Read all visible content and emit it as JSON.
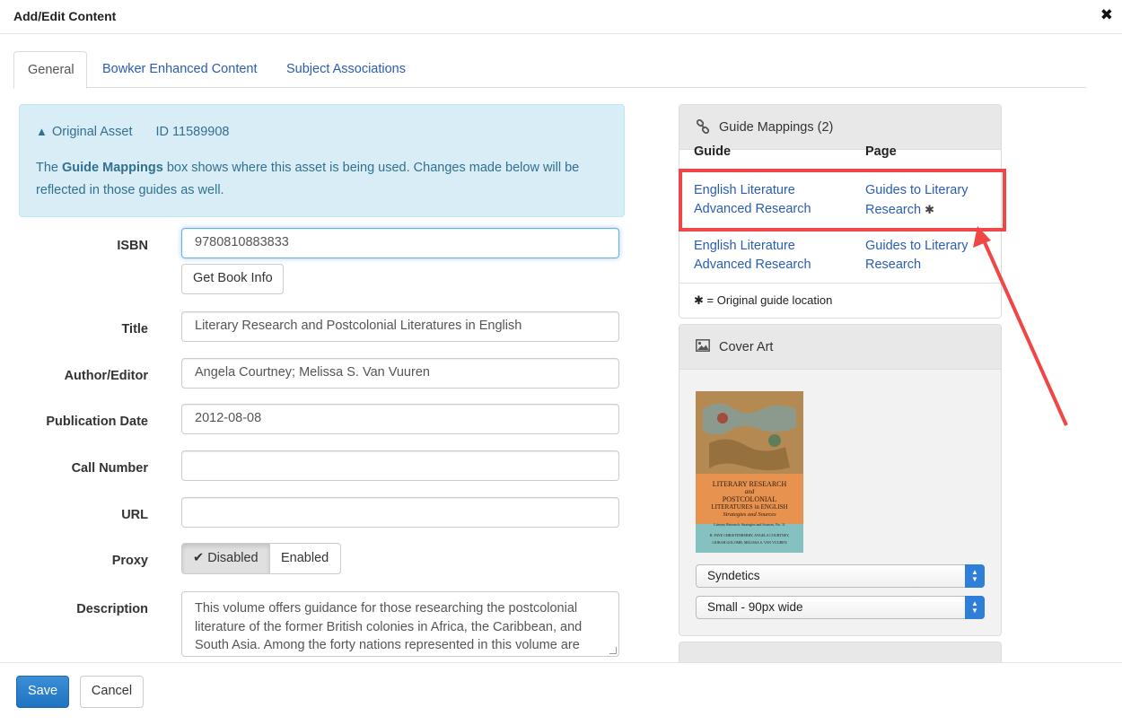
{
  "modal": {
    "title": "Add/Edit Content",
    "close_symbol": "✖"
  },
  "tabs": [
    {
      "label": "General",
      "active": true
    },
    {
      "label": "Bowker Enhanced Content",
      "active": false
    },
    {
      "label": "Subject Associations",
      "active": false
    }
  ],
  "info": {
    "asset_label": "Original Asset",
    "asset_id": "ID 11589908",
    "text_before": "The ",
    "text_bold": "Guide Mappings",
    "text_after": " box shows where this asset is being used. Changes made below will be reflected in those guides as well."
  },
  "form": {
    "isbn": {
      "label": "ISBN",
      "value": "9780810883833",
      "button": "Get Book Info"
    },
    "title": {
      "label": "Title",
      "value": "Literary Research and Postcolonial Literatures in English"
    },
    "author": {
      "label": "Author/Editor",
      "value": "Angela Courtney; Melissa S. Van Vuuren"
    },
    "pub_date": {
      "label": "Publication Date",
      "value": "2012-08-08"
    },
    "call_number": {
      "label": "Call Number",
      "value": ""
    },
    "url": {
      "label": "URL",
      "value": ""
    },
    "proxy": {
      "label": "Proxy",
      "options": [
        "Disabled",
        "Enabled"
      ],
      "selected": "Disabled"
    },
    "description": {
      "label": "Description",
      "value": "This volume offers guidance for those researching the postcolonial literature of the former British colonies in Africa, the Caribbean, and South Asia. Among the forty nations represented in this volume are"
    }
  },
  "guide_mappings": {
    "title": "Guide Mappings (2)",
    "col_guide": "Guide",
    "col_page": "Page",
    "rows": [
      {
        "guide_line1": "English Literature",
        "guide_line2": "Advanced Research",
        "page_line1": "Guides to Literary",
        "page_line2": "Research",
        "original": true
      },
      {
        "guide_line1": "English Literature",
        "guide_line2": "Advanced Research",
        "page_line1": "Guides to Literary",
        "page_line2": "Research",
        "original": false
      }
    ],
    "footnote_symbol": "✱",
    "footnote": "= Original guide location"
  },
  "cover_art": {
    "title": "Cover Art",
    "book_cover": {
      "title_line1": "LITERARY RESEARCH",
      "title_line2": "and",
      "title_line3": "POSTCOLONIAL",
      "title_line4": "LITERATURES in ENGLISH",
      "subtitle": "Strategies and Sources",
      "series": "Literary Research: Strategies and Sources, No. 11",
      "authors_line1": "H. FAYE CHRISTENBERRY, ANGELA COURTNEY,",
      "authors_line2": "LIORAH GOLOMB, MELISSA S. VAN VUUREN"
    },
    "source_select": "Syndetics",
    "size_select": "Small - 90px wide"
  },
  "footer": {
    "save_label": "Save",
    "cancel_label": "Cancel"
  },
  "colors": {
    "link": "#2a5db0",
    "info_bg": "#d9edf7",
    "info_text": "#31708f",
    "annotation": "#f04646",
    "primary": "#2073c0"
  }
}
